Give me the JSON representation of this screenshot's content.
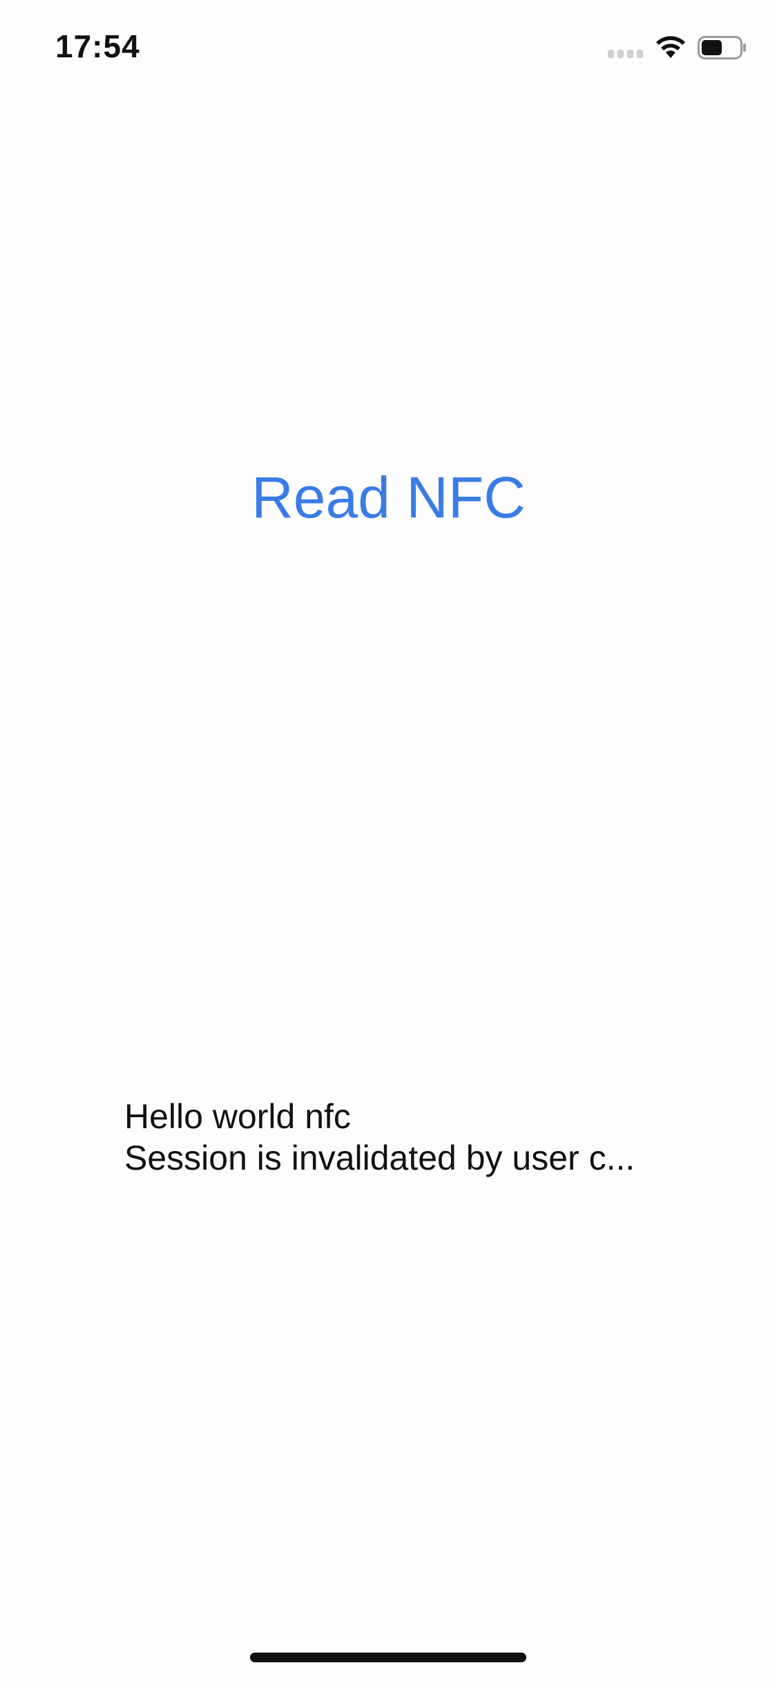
{
  "status_bar": {
    "time": "17:54",
    "signal_icon": "cellular-signal-icon",
    "wifi_icon": "wifi-icon",
    "battery_icon": "battery-icon",
    "battery_level": 0.55
  },
  "main": {
    "read_button_label": "Read NFC",
    "accent_color": "#3a7ce6"
  },
  "result": {
    "line1": "Hello world nfc",
    "line2": "Session is invalidated by user c..."
  }
}
